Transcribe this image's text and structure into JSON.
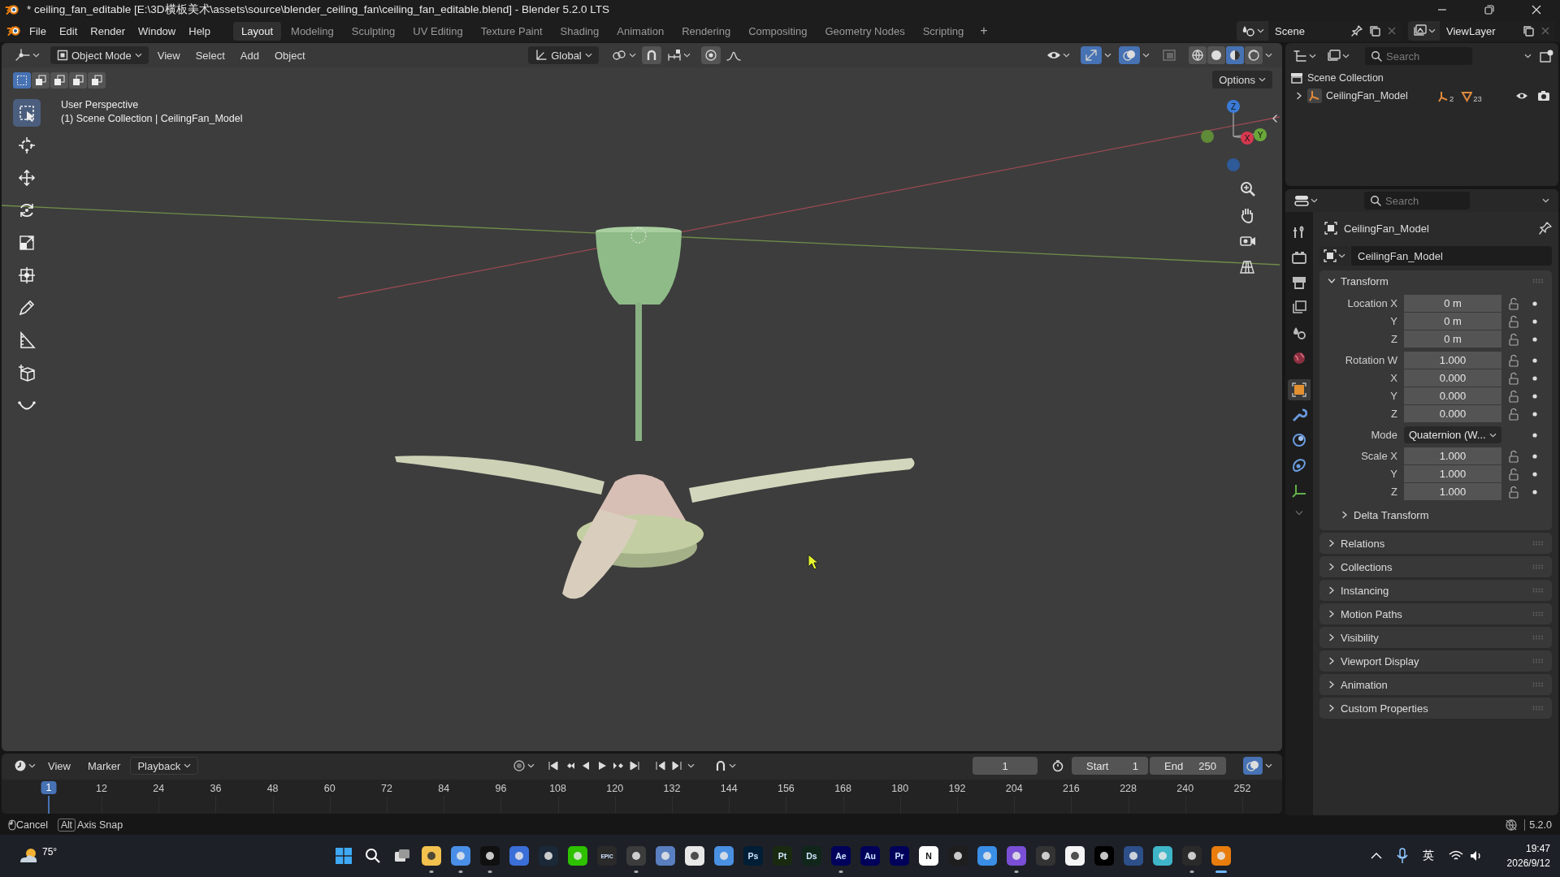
{
  "window": {
    "title": "* ceiling_fan_editable [E:\\3D横板美术\\assets\\source\\blender_ceiling_fan\\ceiling_fan_editable.blend] - Blender 5.2.0 LTS"
  },
  "menu": [
    "File",
    "Edit",
    "Render",
    "Window",
    "Help"
  ],
  "workspace_tabs": [
    {
      "label": "Layout",
      "selected": true
    },
    {
      "label": "Modeling",
      "selected": false
    },
    {
      "label": "Sculpting",
      "selected": false
    },
    {
      "label": "UV Editing",
      "selected": false
    },
    {
      "label": "Texture Paint",
      "selected": false
    },
    {
      "label": "Shading",
      "selected": false
    },
    {
      "label": "Animation",
      "selected": false
    },
    {
      "label": "Rendering",
      "selected": false
    },
    {
      "label": "Compositing",
      "selected": false
    },
    {
      "label": "Geometry Nodes",
      "selected": false
    },
    {
      "label": "Scripting",
      "selected": false
    }
  ],
  "add_tab": "+",
  "scene": "Scene",
  "view_layer": "ViewLayer",
  "viewport": {
    "mode": "Object Mode",
    "menus": [
      "View",
      "Select",
      "Add",
      "Object"
    ],
    "orientation": "Global",
    "options": "Options",
    "info": [
      "User Perspective",
      "(1) Scene Collection | CeilingFan_Model"
    ],
    "select_modes": [
      {
        "selected": true
      },
      {
        "selected": false
      },
      {
        "selected": false
      },
      {
        "selected": false
      },
      {
        "selected": false
      }
    ],
    "shading": [
      {
        "selected": false
      },
      {
        "selected": false
      },
      {
        "selected": true
      },
      {
        "selected": false
      }
    ],
    "tools": [
      {
        "kind": "select",
        "selected": true
      },
      {
        "kind": "cursor",
        "selected": false
      },
      {
        "kind": "move",
        "selected": false
      },
      {
        "kind": "rotate",
        "selected": false
      },
      {
        "kind": "scale",
        "selected": false
      },
      {
        "kind": "transform",
        "selected": false
      },
      {
        "kind": "annotate",
        "selected": false
      },
      {
        "kind": "measure",
        "selected": false
      },
      {
        "kind": "add_cube",
        "selected": false
      },
      {
        "kind": "curve",
        "selected": false
      }
    ],
    "gizmo_axes": [
      "Z",
      "X",
      "Y"
    ]
  },
  "outliner": {
    "search_placeholder": "Search",
    "root": "Scene Collection",
    "items": [
      {
        "name": "CeilingFan_Model",
        "expanded": false,
        "badges": [
          "2",
          "23"
        ]
      }
    ]
  },
  "properties": {
    "search_placeholder": "Search",
    "object": "CeilingFan_Model",
    "object_data": "CeilingFan_Model",
    "tabs": [
      {
        "kind": "tool",
        "selected": false
      },
      {
        "kind": "render",
        "selected": false
      },
      {
        "kind": "output",
        "selected": false
      },
      {
        "kind": "view_layer",
        "selected": false
      },
      {
        "kind": "scene",
        "selected": false
      },
      {
        "kind": "world",
        "selected": false
      },
      {
        "kind": "object",
        "selected": true
      },
      {
        "kind": "modifiers",
        "selected": false
      },
      {
        "kind": "physics",
        "selected": false
      },
      {
        "kind": "constraints",
        "selected": false
      },
      {
        "kind": "data",
        "selected": false
      }
    ],
    "transform": {
      "title": "Transform",
      "expanded": true,
      "groups": [
        [
          {
            "kind": "number",
            "label": "Location X",
            "value": "0 m"
          },
          {
            "kind": "number",
            "label": "Y",
            "value": "0 m"
          },
          {
            "kind": "number",
            "label": "Z",
            "value": "0 m"
          }
        ],
        [
          {
            "kind": "number",
            "label": "Rotation W",
            "value": "1.000"
          },
          {
            "kind": "number",
            "label": "X",
            "value": "0.000"
          },
          {
            "kind": "number",
            "label": "Y",
            "value": "0.000"
          },
          {
            "kind": "number",
            "label": "Z",
            "value": "0.000"
          }
        ],
        [
          {
            "kind": "menu",
            "label": "Mode",
            "value": "Quaternion (W..."
          }
        ],
        [
          {
            "kind": "number",
            "label": "Scale X",
            "value": "1.000"
          },
          {
            "kind": "number",
            "label": "Y",
            "value": "1.000"
          },
          {
            "kind": "number",
            "label": "Z",
            "value": "1.000"
          }
        ]
      ],
      "subpanels": [
        {
          "title": "Delta Transform",
          "expanded": false
        }
      ]
    },
    "panels": [
      {
        "title": "Relations",
        "expanded": false
      },
      {
        "title": "Collections",
        "expanded": false
      },
      {
        "title": "Instancing",
        "expanded": false
      },
      {
        "title": "Motion Paths",
        "expanded": false
      },
      {
        "title": "Visibility",
        "expanded": false
      },
      {
        "title": "Viewport Display",
        "expanded": false
      },
      {
        "title": "Animation",
        "expanded": false
      },
      {
        "title": "Custom Properties",
        "expanded": false
      }
    ]
  },
  "timeline": {
    "auto_keying": false,
    "menus": [
      "View",
      "Marker"
    ],
    "playback": "Playback",
    "current_frame": "1",
    "start_label": "Start",
    "start": "1",
    "end_label": "End",
    "end": "250",
    "playhead": "1",
    "ticks": [
      "12",
      "24",
      "36",
      "48",
      "60",
      "72",
      "84",
      "96",
      "108",
      "120",
      "132",
      "144",
      "156",
      "168",
      "180",
      "192",
      "204",
      "216",
      "228",
      "240",
      "252"
    ]
  },
  "status": {
    "hints": [
      {
        "kind": "mouse",
        "label": "Cancel"
      },
      {
        "kind": "key",
        "key": "Alt",
        "label": "Axis Snap"
      }
    ],
    "version": "5.2.0"
  },
  "taskbar": {
    "weather": "75°",
    "apps": [
      {
        "kind": "start",
        "running": false,
        "active": false
      },
      {
        "kind": "search",
        "running": false,
        "active": false
      },
      {
        "kind": "taskview",
        "running": false,
        "active": false
      },
      {
        "kind": "tile",
        "color": "#f2c14e",
        "running": true,
        "active": false
      },
      {
        "kind": "tile",
        "color": "#4a8fe7",
        "running": true,
        "active": false
      },
      {
        "kind": "tile",
        "color": "#101010",
        "running": true,
        "active": false
      },
      {
        "kind": "tile",
        "color": "#3b6fd8",
        "running": false,
        "active": false
      },
      {
        "kind": "tile",
        "color": "#1b2838",
        "running": false,
        "active": false
      },
      {
        "kind": "tile",
        "color": "#2dc100",
        "running": false,
        "active": false
      },
      {
        "kind": "tile",
        "color": "#2a2a2a",
        "glyph": "EPIC",
        "running": false,
        "active": false
      },
      {
        "kind": "tile",
        "color": "#3c3c3c",
        "running": true,
        "active": false
      },
      {
        "kind": "tile",
        "color": "#5a7fc0",
        "running": false,
        "active": false
      },
      {
        "kind": "tile",
        "color": "#e8e8e8",
        "running": false,
        "active": false
      },
      {
        "kind": "tile",
        "color": "#4a90e2",
        "running": false,
        "active": false
      },
      {
        "kind": "tile",
        "color": "#001e36",
        "glyph": "Ps",
        "running": false,
        "active": false
      },
      {
        "kind": "tile",
        "color": "#1a2a10",
        "glyph": "Pt",
        "running": false,
        "active": false
      },
      {
        "kind": "tile",
        "color": "#10261a",
        "glyph": "Ds",
        "running": false,
        "active": false
      },
      {
        "kind": "tile",
        "color": "#00005b",
        "glyph": "Ae",
        "running": true,
        "active": false
      },
      {
        "kind": "tile",
        "color": "#00005b",
        "glyph": "Au",
        "running": false,
        "active": false
      },
      {
        "kind": "tile",
        "color": "#00005b",
        "glyph": "Pr",
        "running": false,
        "active": false
      },
      {
        "kind": "tile",
        "color": "#ffffff",
        "glyph": "N",
        "running": false,
        "active": false
      },
      {
        "kind": "tile",
        "color": "#1e1e1e",
        "running": false,
        "active": false
      },
      {
        "kind": "tile",
        "color": "#3a8ee6",
        "running": false,
        "active": false
      },
      {
        "kind": "tile",
        "color": "#7a4fd6",
        "running": true,
        "active": false
      },
      {
        "kind": "tile",
        "color": "#333333",
        "running": false,
        "active": false
      },
      {
        "kind": "tile",
        "color": "#f5f5f5",
        "running": false,
        "active": false
      },
      {
        "kind": "tile",
        "color": "#000000",
        "running": false,
        "active": false
      },
      {
        "kind": "tile",
        "color": "#2d4f8a",
        "running": false,
        "active": false
      },
      {
        "kind": "tile",
        "color": "#3fb6c8",
        "running": false,
        "active": false
      },
      {
        "kind": "tile",
        "color": "#2a2a2a",
        "running": true,
        "active": false
      },
      {
        "kind": "tile",
        "color": "#e87d0d",
        "running": true,
        "active": true
      }
    ],
    "ime": "英",
    "time": "19:47",
    "date": "2026/9/12"
  }
}
